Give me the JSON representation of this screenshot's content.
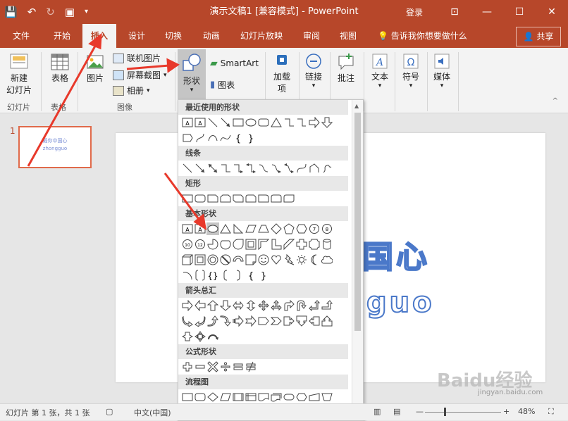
{
  "window": {
    "title": "演示文稿1 [兼容模式] - PowerPoint",
    "login": "登录",
    "share": "共享"
  },
  "tabs": [
    "文件",
    "开始",
    "插入",
    "设计",
    "切换",
    "动画",
    "幻灯片放映",
    "审阅",
    "视图"
  ],
  "tell_me": "告诉我你想要做什么",
  "ribbon": {
    "new_slide": "新建\n幻灯片",
    "new_slide_l1": "新建",
    "new_slide_l2": "幻灯片",
    "table": "表格",
    "picture": "图片",
    "online_picture": "联机图片",
    "screenshot": "屏幕截图",
    "album": "相册",
    "shapes": "形状",
    "smartart": "SmartArt",
    "chart": "图表",
    "addins": "加载",
    "addins_l2": "项",
    "link": "链接",
    "comment": "批注",
    "text": "文本",
    "symbol": "符号",
    "media": "媒体",
    "group_slides": "幻灯片",
    "group_table": "表格",
    "group_images": "图像"
  },
  "slide_panel": {
    "slide_number": "1",
    "thumb_line1": "戴你中国心",
    "thumb_line2": "zhongguo"
  },
  "slide_text": {
    "line1": "国心",
    "line2": "guo"
  },
  "gallery": {
    "sections": [
      "最近使用的形状",
      "线条",
      "矩形",
      "基本形状",
      "箭头总汇",
      "公式形状",
      "流程图"
    ]
  },
  "status": {
    "slide_info": "幻灯片 第 1 张，共 1 张",
    "language": "中文(中国)",
    "zoom": "48%"
  },
  "watermark": {
    "brand": "Baidu经验",
    "url": "jingyan.baidu.com"
  },
  "colors": {
    "accent": "#b7472a",
    "highlight": "#e8392b",
    "text_outline": "#4a78c9"
  }
}
